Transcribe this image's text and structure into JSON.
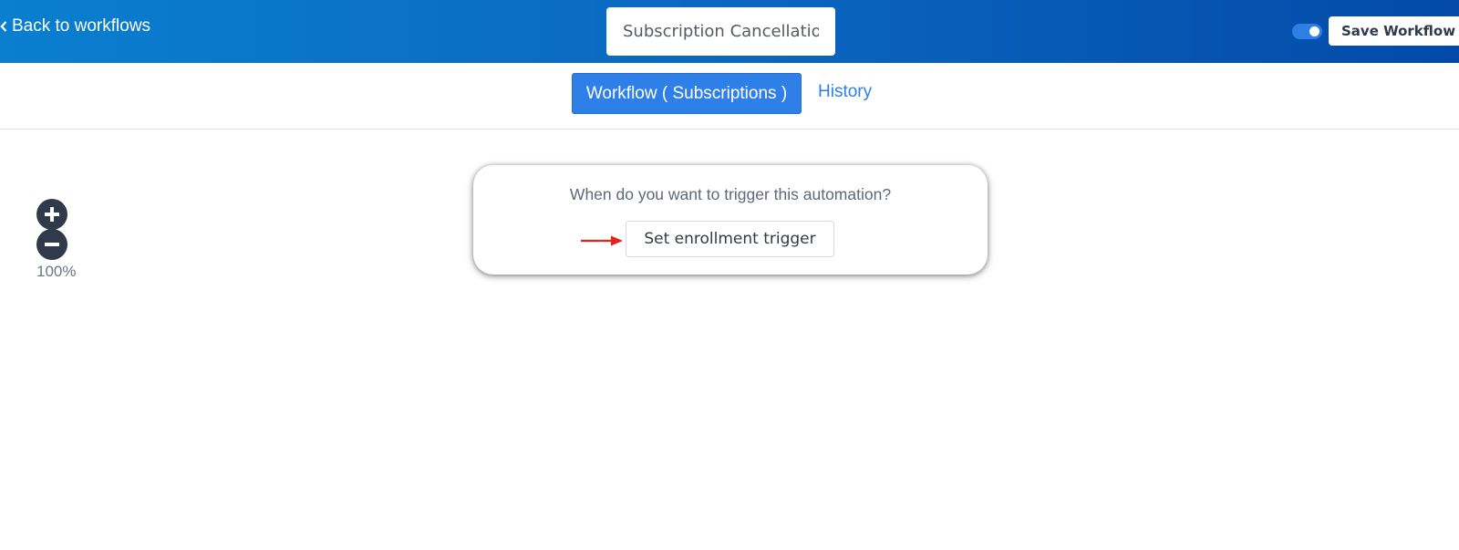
{
  "header": {
    "back_label": "Back to workflows",
    "workflow_name_value": "Subscription Cancellation",
    "workflow_name_placeholder": "",
    "save_label": "Save Workflow",
    "active_toggle_on": true,
    "gradient_colors": [
      "#0a7fcf",
      "#034aa8"
    ]
  },
  "tabs": [
    {
      "label": "Workflow ( Subscriptions )",
      "active": true
    },
    {
      "label": "History",
      "active": false
    }
  ],
  "canvas": {
    "zoom_level": "100%",
    "trigger_card": {
      "question": "When do you want to trigger this automation?",
      "button_label": "Set enrollment trigger"
    }
  },
  "icons": {
    "back": "chevron-left-icon",
    "zoom_in": "plus-icon",
    "zoom_out": "minus-icon",
    "annotation": "red-arrow-icon"
  },
  "colors": {
    "accent": "#2e80e8",
    "dark": "#2f3a4b",
    "annotation": "#e8231a"
  }
}
